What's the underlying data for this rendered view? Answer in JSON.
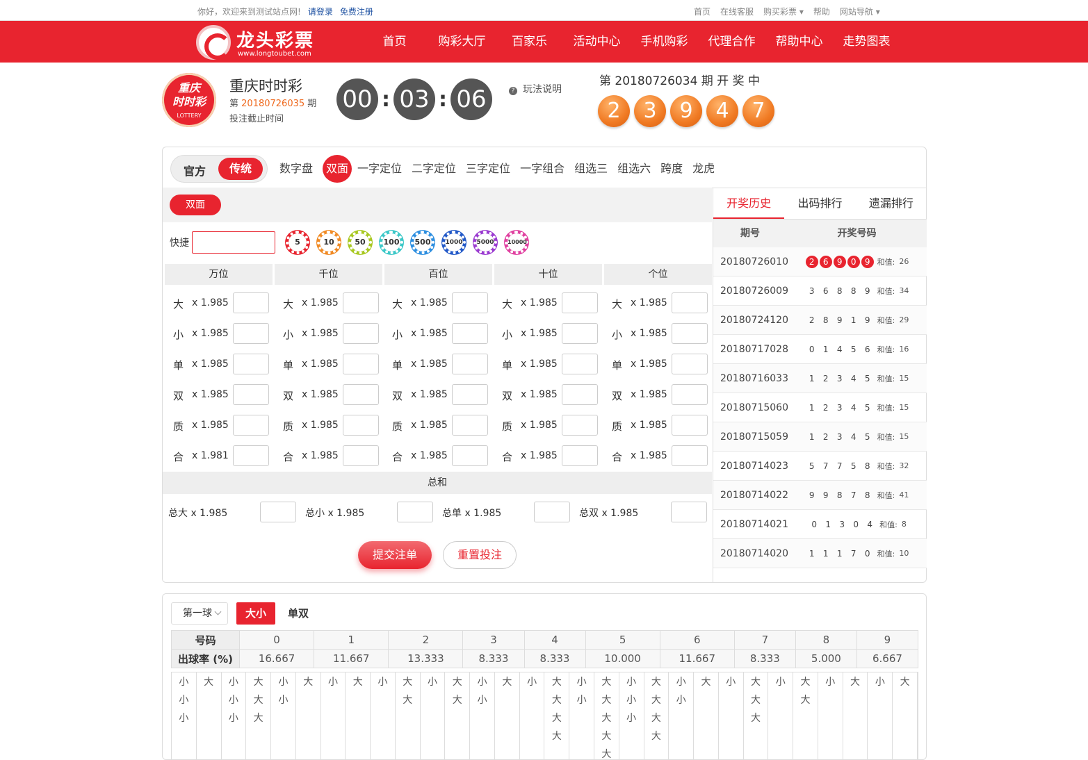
{
  "topbar": {
    "greeting": "你好，欢迎来到测试站点网!",
    "login": "请登录",
    "register": "免费注册",
    "links": [
      "首页",
      "在线客服",
      "购买彩票 ▾",
      "帮助",
      "网站导航 ▾"
    ]
  },
  "brand": {
    "name": "龙头彩票",
    "url": "www.longtoubet.com"
  },
  "nav": [
    "首页",
    "购彩大厅",
    "百家乐",
    "活动中心",
    "手机购彩",
    "代理合作",
    "帮助中心",
    "走势图表"
  ],
  "game": {
    "logo_top": "重庆",
    "logo_main": "时时彩",
    "logo_sub": "LOTTERY",
    "name": "重庆时时彩",
    "issue_prefix": "第",
    "issue": "20180726035",
    "issue_suffix": "期",
    "deadline_label": "投注截止时间",
    "timer": [
      "00",
      "03",
      "06"
    ],
    "rules": "玩法说明",
    "draw_title": "第 20180726034 期 开 奖 中",
    "draw_balls": [
      "2",
      "3",
      "9",
      "4",
      "7"
    ]
  },
  "mode": {
    "official": "官方",
    "traditional": "传统"
  },
  "subtabs": [
    "数字盘",
    "双面",
    "一字定位",
    "二字定位",
    "三字定位",
    "一字组合",
    "组选三",
    "组选六",
    "跨度",
    "龙虎"
  ],
  "subtab_active": "双面",
  "bet": {
    "pill": "双面",
    "quick_label": "快捷",
    "chips": [
      {
        "v": "5",
        "color": "#e8242f"
      },
      {
        "v": "10",
        "color": "#f08a24"
      },
      {
        "v": "50",
        "color": "#a8c820"
      },
      {
        "v": "100",
        "color": "#3cc8c8"
      },
      {
        "v": "500",
        "color": "#2e8fe0"
      },
      {
        "v": "1000",
        "color": "#2259c8"
      },
      {
        "v": "5000",
        "color": "#9a3ad0"
      },
      {
        "v": "10000",
        "color": "#e040a0"
      }
    ],
    "positions": [
      "万位",
      "千位",
      "百位",
      "十位",
      "个位"
    ],
    "rows": [
      {
        "label": "大",
        "odds": [
          "x 1.985",
          "x 1.985",
          "x 1.985",
          "x 1.985",
          "x 1.985"
        ]
      },
      {
        "label": "小",
        "odds": [
          "x 1.985",
          "x 1.985",
          "x 1.985",
          "x 1.985",
          "x 1.985"
        ]
      },
      {
        "label": "单",
        "odds": [
          "x 1.985",
          "x 1.985",
          "x 1.985",
          "x 1.985",
          "x 1.985"
        ]
      },
      {
        "label": "双",
        "odds": [
          "x 1.985",
          "x 1.985",
          "x 1.985",
          "x 1.985",
          "x 1.985"
        ]
      },
      {
        "label": "质",
        "odds": [
          "x 1.985",
          "x 1.985",
          "x 1.985",
          "x 1.985",
          "x 1.985"
        ]
      },
      {
        "label": "合",
        "odds": [
          "x 1.981",
          "x 1.985",
          "x 1.985",
          "x 1.985",
          "x 1.985"
        ]
      }
    ],
    "sum_title": "总和",
    "sums": [
      "总大 x 1.985",
      "总小 x 1.985",
      "总单 x 1.985",
      "总双 x 1.985"
    ],
    "submit": "提交注单",
    "reset": "重置投注"
  },
  "history": {
    "tabs": [
      "开奖历史",
      "出码排行",
      "遗漏排行"
    ],
    "col_issue": "期号",
    "col_nums": "开奖号码",
    "sum_label": "和值:",
    "rows": [
      {
        "issue": "20180726010",
        "nums": [
          "2",
          "6",
          "9",
          "0",
          "9"
        ],
        "sum": "26",
        "highlight": true
      },
      {
        "issue": "20180726009",
        "nums": [
          "3",
          "6",
          "8",
          "8",
          "9"
        ],
        "sum": "34",
        "highlight": false
      },
      {
        "issue": "20180724120",
        "nums": [
          "2",
          "8",
          "9",
          "1",
          "9"
        ],
        "sum": "29",
        "highlight": false
      },
      {
        "issue": "20180717028",
        "nums": [
          "0",
          "1",
          "4",
          "5",
          "6"
        ],
        "sum": "16",
        "highlight": false
      },
      {
        "issue": "20180716033",
        "nums": [
          "1",
          "2",
          "3",
          "4",
          "5"
        ],
        "sum": "15",
        "highlight": false
      },
      {
        "issue": "20180715060",
        "nums": [
          "1",
          "2",
          "3",
          "4",
          "5"
        ],
        "sum": "15",
        "highlight": false
      },
      {
        "issue": "20180715059",
        "nums": [
          "1",
          "2",
          "3",
          "4",
          "5"
        ],
        "sum": "15",
        "highlight": false
      },
      {
        "issue": "20180714023",
        "nums": [
          "5",
          "7",
          "7",
          "5",
          "8"
        ],
        "sum": "32",
        "highlight": false
      },
      {
        "issue": "20180714022",
        "nums": [
          "9",
          "9",
          "8",
          "7",
          "8"
        ],
        "sum": "41",
        "highlight": false
      },
      {
        "issue": "20180714021",
        "nums": [
          "0",
          "1",
          "3",
          "0",
          "4"
        ],
        "sum": "8",
        "highlight": false
      },
      {
        "issue": "20180714020",
        "nums": [
          "1",
          "1",
          "1",
          "7",
          "0"
        ],
        "sum": "10",
        "highlight": false
      }
    ]
  },
  "stats": {
    "ball_select": "第一球",
    "btn_bigsmall": "大小",
    "btn_oddeven": "单双",
    "header_label": "号码",
    "rate_label": "出球率 (%)",
    "numbers": [
      "0",
      "1",
      "2",
      "3",
      "4",
      "5",
      "6",
      "7",
      "8",
      "9"
    ],
    "rates": [
      "16.667",
      "11.667",
      "13.333",
      "8.333",
      "8.333",
      "10.000",
      "11.667",
      "8.333",
      "5.000",
      "6.667"
    ],
    "trend": [
      [
        "小",
        "小",
        "小"
      ],
      [
        "大"
      ],
      [
        "小",
        "小",
        "小"
      ],
      [
        "大",
        "大",
        "大"
      ],
      [
        "小",
        "小"
      ],
      [
        "大"
      ],
      [
        "小"
      ],
      [
        "大"
      ],
      [
        "小"
      ],
      [
        "大",
        "大"
      ],
      [
        "小"
      ],
      [
        "大",
        "大"
      ],
      [
        "小",
        "小"
      ],
      [
        "大"
      ],
      [
        "小"
      ],
      [
        "大",
        "大",
        "大",
        "大"
      ],
      [
        "小",
        "小"
      ],
      [
        "大",
        "大",
        "大",
        "大",
        "大"
      ],
      [
        "小",
        "小",
        "小"
      ],
      [
        "大",
        "大",
        "大",
        "大"
      ],
      [
        "小",
        "小"
      ],
      [
        "大"
      ],
      [
        "小"
      ],
      [
        "大",
        "大",
        "大"
      ],
      [
        "小"
      ],
      [
        "大",
        "大"
      ],
      [
        "小"
      ],
      [
        "大"
      ],
      [
        "小"
      ],
      [
        "大"
      ]
    ]
  }
}
